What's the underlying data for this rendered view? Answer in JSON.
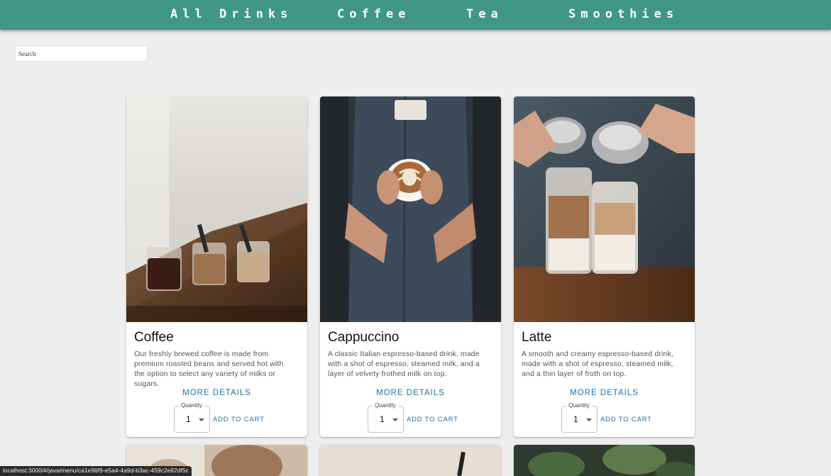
{
  "nav": {
    "items": [
      "All Drinks",
      "Coffee",
      "Tea",
      "Smoothies"
    ]
  },
  "search": {
    "placeholder": "Search"
  },
  "products": [
    {
      "title": "Coffee",
      "description": "Our freshly brewed coffee is made from premium roasted beans and served hot with the option to select any variety of milks or sugars.",
      "more_label": "MORE DETAILS",
      "quantity_label": "Quantity",
      "quantity": "1",
      "add_label": "ADD TO CART"
    },
    {
      "title": "Cappuccino",
      "description": "A classic Italian espresso-based drink, made with a shot of espresso, steamed milk, and a layer of velvety frothed milk on top.",
      "more_label": "MORE DETAILS",
      "quantity_label": "Quantity",
      "quantity": "1",
      "add_label": "ADD TO CART"
    },
    {
      "title": "Latte",
      "description": "A smooth and creamy espresso-based drink, made with a shot of espresso, steamed milk, and a thin layer of froth on top.",
      "more_label": "MORE DETAILS",
      "quantity_label": "Quantity",
      "quantity": "1",
      "add_label": "ADD TO CART"
    }
  ],
  "status_bar": {
    "url": "localhost:3000/#/java/menu/ca1e96f9-e5a4-4a9d-b3ac-459c2e82df5c"
  },
  "colors": {
    "navbar": "#3f9784",
    "link": "#1f6fa8",
    "background": "#eeeeee"
  }
}
